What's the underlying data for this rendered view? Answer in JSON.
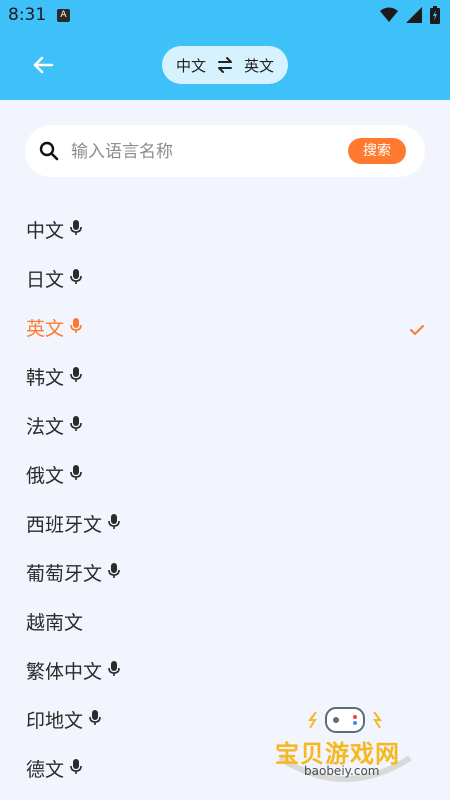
{
  "status_bar": {
    "time": "8:31",
    "notification_icon": "A"
  },
  "header": {
    "source_lang": "中文",
    "target_lang": "英文",
    "colors": {
      "bar": "#3ec1f9",
      "pill": "#d7f2ff"
    }
  },
  "search": {
    "placeholder": "输入语言名称",
    "button_label": "搜索"
  },
  "languages": [
    {
      "label": "中文",
      "mic": true,
      "selected": false
    },
    {
      "label": "日文",
      "mic": true,
      "selected": false
    },
    {
      "label": "英文",
      "mic": true,
      "selected": true
    },
    {
      "label": "韩文",
      "mic": true,
      "selected": false
    },
    {
      "label": "法文",
      "mic": true,
      "selected": false
    },
    {
      "label": "俄文",
      "mic": true,
      "selected": false
    },
    {
      "label": "西班牙文",
      "mic": true,
      "selected": false
    },
    {
      "label": "葡萄牙文",
      "mic": true,
      "selected": false
    },
    {
      "label": "越南文",
      "mic": false,
      "selected": false
    },
    {
      "label": "繁体中文",
      "mic": true,
      "selected": false
    },
    {
      "label": "印地文",
      "mic": true,
      "selected": false
    },
    {
      "label": "德文",
      "mic": true,
      "selected": false
    }
  ],
  "accent_color": "#ff7a2e",
  "watermark": {
    "brand": "宝贝游戏网",
    "domain": "baobeiy.com"
  }
}
